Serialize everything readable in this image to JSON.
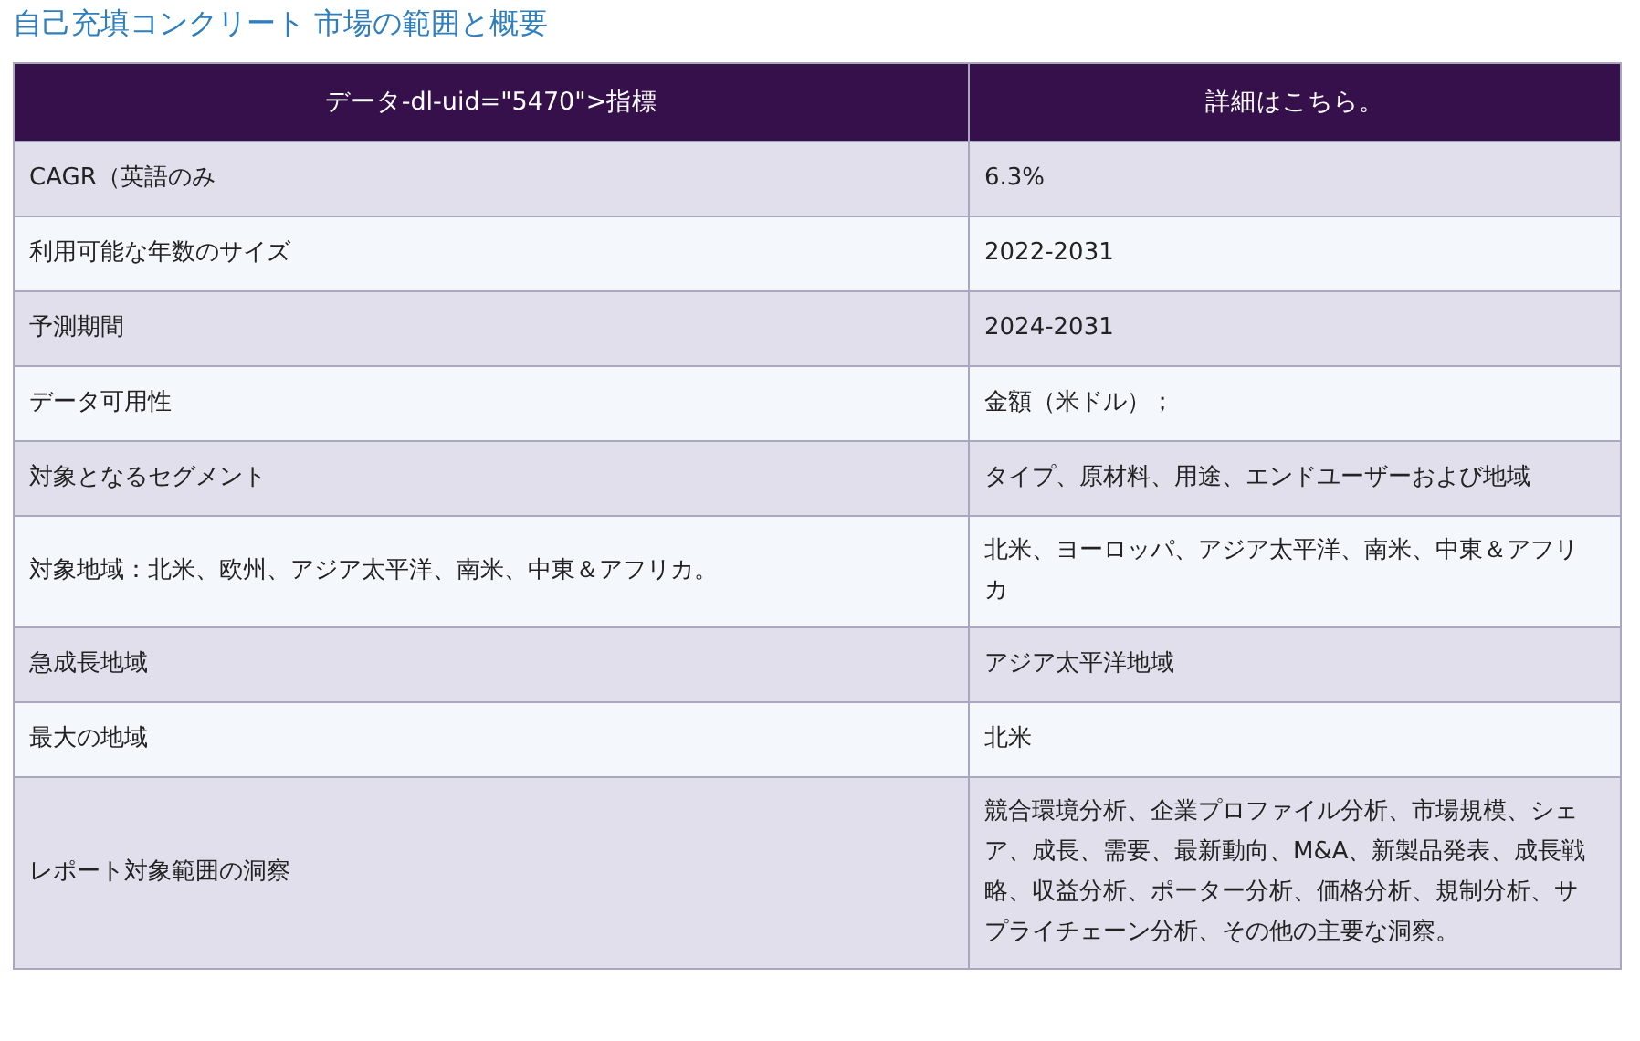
{
  "title": "自己充填コンクリート 市場の範囲と概要",
  "table": {
    "columns": [
      "データ-dl-uid=\"5470\">指標",
      "詳細はこちら。"
    ],
    "rows": [
      [
        "CAGR（英語のみ",
        "6.3%"
      ],
      [
        "利用可能な年数のサイズ",
        "2022-2031"
      ],
      [
        "予測期間",
        "2024-2031"
      ],
      [
        "データ可用性",
        "金額（米ドル）；"
      ],
      [
        "対象となるセグメント",
        "タイプ、原材料、用途、エンドユーザーおよび地域"
      ],
      [
        "対象地域：北米、欧州、アジア太平洋、南米、中東＆アフリカ。",
        "北米、ヨーロッパ、アジア太平洋、南米、中東＆アフリカ"
      ],
      [
        "急成長地域",
        "アジア太平洋地域"
      ],
      [
        "最大の地域",
        "北米"
      ],
      [
        "レポート対象範囲の洞察",
        "競合環境分析、企業プロファイル分析、市場規模、シェア、成長、需要、最新動向、M&A、新製品発表、成長戦略、収益分析、ポーター分析、価格分析、規制分析、サプライチェーン分析、その他の主要な洞察。"
      ]
    ]
  }
}
